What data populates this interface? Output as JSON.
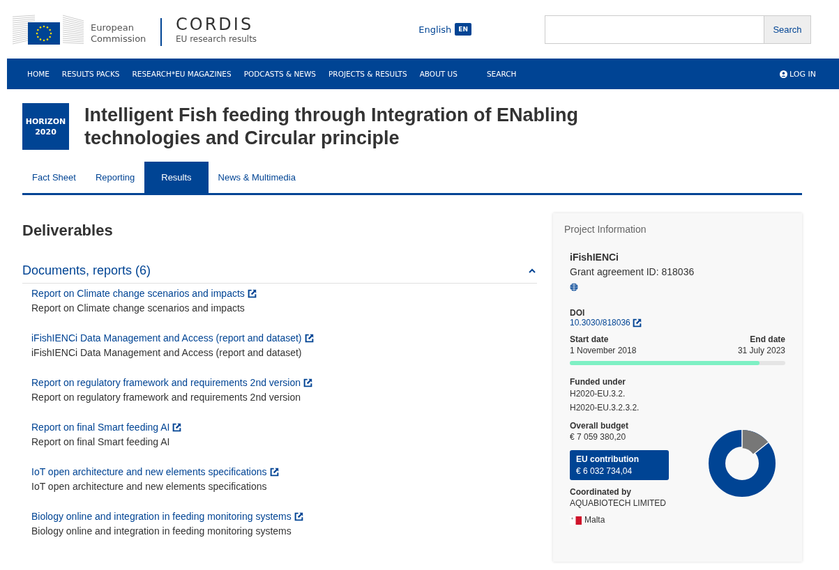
{
  "header": {
    "org_name": "European Commission",
    "site_name": "CORDIS",
    "site_tagline": "EU research results",
    "language": {
      "label": "English",
      "code": "EN"
    },
    "search": {
      "button": "Search"
    }
  },
  "nav": {
    "items": [
      {
        "label": "HOME"
      },
      {
        "label": "RESULTS PACKS"
      },
      {
        "label": "RESEARCH*EU MAGAZINES"
      },
      {
        "label": "PODCASTS & NEWS"
      },
      {
        "label": "PROJECTS & RESULTS"
      },
      {
        "label": "ABOUT US"
      },
      {
        "label": "SEARCH"
      }
    ],
    "login": "LOG IN"
  },
  "project": {
    "programme_badge": [
      "HORIZON",
      "2020"
    ],
    "title": "Intelligent Fish feeding through Integration of ENabling technologies and Circular principle"
  },
  "tabs": [
    {
      "label": "Fact Sheet",
      "selected": false
    },
    {
      "label": "Reporting",
      "selected": false
    },
    {
      "label": "Results",
      "selected": true
    },
    {
      "label": "News & Multimedia",
      "selected": false
    }
  ],
  "deliverables": {
    "heading": "Deliverables",
    "section": {
      "title": "Documents, reports (6)",
      "expanded": true,
      "items": [
        {
          "link": "Report on Climate change scenarios and impacts",
          "description": "Report on Climate change scenarios and impacts"
        },
        {
          "link": "iFishIENCi Data Management and Access (report and dataset)",
          "description": "iFishIENCi Data Management and Access (report and dataset)"
        },
        {
          "link": "Report on regulatory framework and requirements 2nd version",
          "description": "Report on regulatory framework and requirements 2nd version"
        },
        {
          "link": "Report on final Smart feeding AI",
          "description": "Report on final Smart feeding AI"
        },
        {
          "link": "IoT open architecture and new elements specifications",
          "description": "IoT open architecture and new elements specifications"
        },
        {
          "link": "Biology online and integration in feeding monitoring systems",
          "description": "Biology online and integration in feeding monitoring systems"
        }
      ]
    }
  },
  "project_information": {
    "heading": "Project Information",
    "acronym": "iFishIENCi",
    "grant": "Grant agreement ID: 818036",
    "doi_label": "DOI",
    "doi": "10.3030/818036",
    "start_label": "Start date",
    "start": "1 November 2018",
    "end_label": "End date",
    "end": "31 July 2023",
    "timeline": {
      "level": 0.88
    },
    "funded_label": "Funded under",
    "funded": [
      "H2020-EU.3.2.",
      "H2020-EU.3.2.3.2."
    ],
    "budget_label": "Overall budget",
    "budget": "€ 7 059 380,20",
    "contribution_label": "EU contribution",
    "contribution": "€ 6 032 734,04",
    "coordinator_label": "Coordinated by",
    "coordinator": "AQUABIOTECH LIMITED",
    "country": "Malta"
  }
}
